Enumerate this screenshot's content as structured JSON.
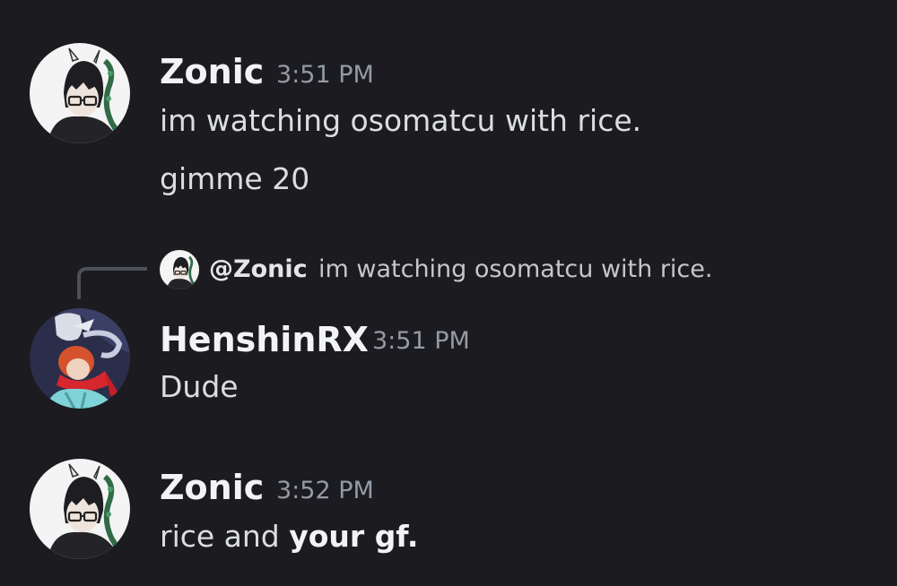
{
  "messages": [
    {
      "author": "Zonic",
      "time": "3:51 PM",
      "lines": [
        "im watching osomatcu with rice.",
        "gimme 20"
      ]
    },
    {
      "author": "HenshinRX",
      "time": "3:51 PM",
      "reply": {
        "author": "@Zonic",
        "text": "im watching osomatcu with rice."
      },
      "lines": [
        "Dude"
      ]
    },
    {
      "author": "Zonic",
      "time": "3:52 PM",
      "text_plain": "rice and ",
      "text_bold": "your gf."
    }
  ],
  "avatars": {
    "zonic": "zonic-avatar",
    "henshinrx": "henshinrx-avatar"
  }
}
